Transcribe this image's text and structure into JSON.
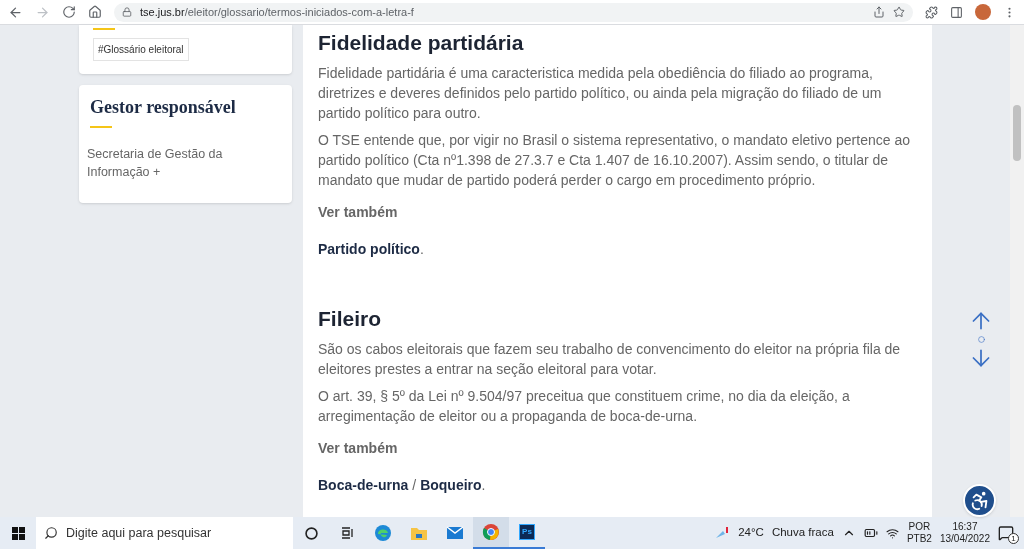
{
  "browser": {
    "url_host": "tse.jus.br",
    "url_path": "/eleitor/glossario/termos-iniciados-com-a-letra-f"
  },
  "sidebar": {
    "tag": "#Glossário eleitoral",
    "gestor_title": "Gestor responsável",
    "gestor_text": "Secretaria de Gestão da Informação +"
  },
  "entries": [
    {
      "title": "Fidelidade partidária",
      "paragraphs": [
        "Fidelidade partidária é uma caracteristica medida pela obediência do filiado ao programa, diretrizes e deveres definidos pelo partido político, ou ainda pela migração do filiado de um partido político para outro.",
        "O TSE entende que, por vigir no Brasil o sistema representativo, o mandato eletivo pertence ao partido político (Cta nº1.398 de 27.3.7 e Cta 1.407 de 16.10.2007). Assim sendo, o titular de mandato que mudar de partido poderá perder o cargo em procedimento próprio."
      ],
      "see_also_label": "Ver também",
      "links": [
        "Partido político"
      ],
      "end": "."
    },
    {
      "title": "Fileiro",
      "paragraphs": [
        "São os cabos eleitorais que fazem seu trabalho de convencimento do eleitor na própria fila de eleitores prestes a entrar na seção eleitoral para votar.",
        "O art. 39, § 5º da Lei nº 9.504/97 preceitua que constituem crime, no dia da eleição, a arregimentação de eleitor ou a propaganda de boca-de-urna."
      ],
      "see_also_label": "Ver também",
      "links": [
        "Boca-de-urna",
        "Boqueiro"
      ],
      "separator": "/",
      "end": "."
    }
  ],
  "taskbar": {
    "search_placeholder": "Digite aqui para pesquisar",
    "temperature": "24°C",
    "weather": "Chuva fraca",
    "lang": "POR",
    "layout": "PTB2",
    "time": "16:37",
    "date": "13/04/2022",
    "notifications": "1",
    "photoshop_label": "Ps"
  }
}
